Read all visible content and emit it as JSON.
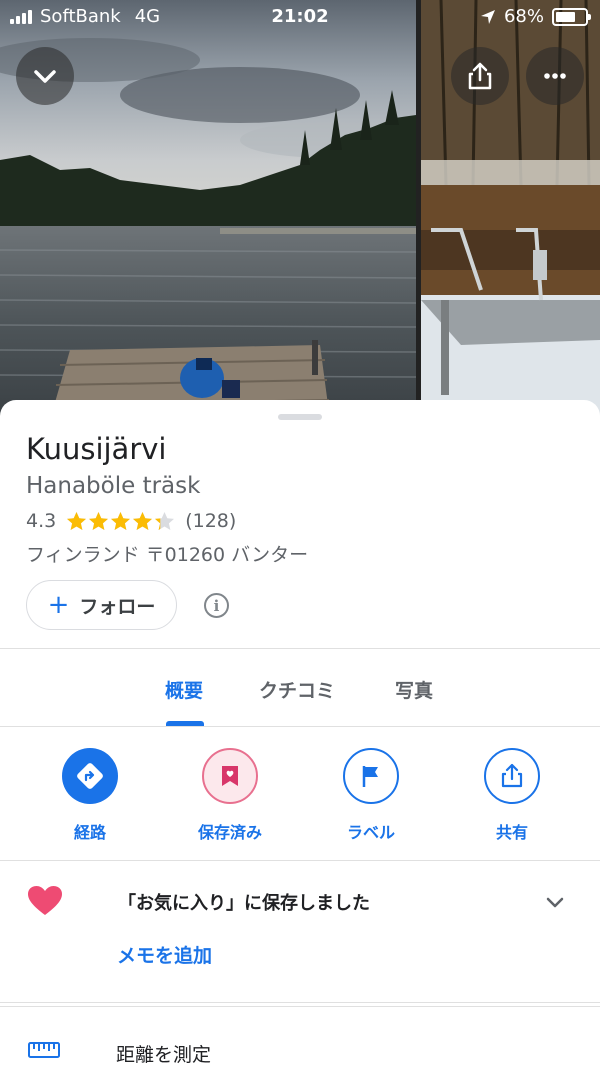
{
  "status_bar": {
    "carrier": "SoftBank",
    "network": "4G",
    "time": "21:02",
    "battery": "68%",
    "battery_level": 0.68
  },
  "header_icons": {
    "collapse": "chevron-down-icon",
    "share": "share-icon",
    "more": "more-icon"
  },
  "place": {
    "name": "Kuusijärvi",
    "alt_name": "Hanaböle träsk",
    "rating": "4.3",
    "rating_value": 4.3,
    "review_count": "(128)",
    "address": "フィンランド 〒01260 バンター"
  },
  "follow": {
    "label": "フォロー",
    "icon": "plus-icon"
  },
  "tabs": [
    {
      "label": "概要",
      "active": true
    },
    {
      "label": "クチコミ",
      "active": false
    },
    {
      "label": "写真",
      "active": false
    }
  ],
  "actions": [
    {
      "label": "経路",
      "icon": "directions-icon"
    },
    {
      "label": "保存済み",
      "icon": "bookmark-icon"
    },
    {
      "label": "ラベル",
      "icon": "flag-icon"
    },
    {
      "label": "共有",
      "icon": "share-icon"
    }
  ],
  "saved": {
    "text": "「お気に入り」に保存しました",
    "memo_link": "メモを追加",
    "icon": "heart-icon"
  },
  "measure": {
    "label": "距離を測定",
    "icon": "ruler-icon"
  },
  "colors": {
    "accent": "#1a73e8",
    "heart": "#ee4b73",
    "star": "#fbbc04"
  }
}
